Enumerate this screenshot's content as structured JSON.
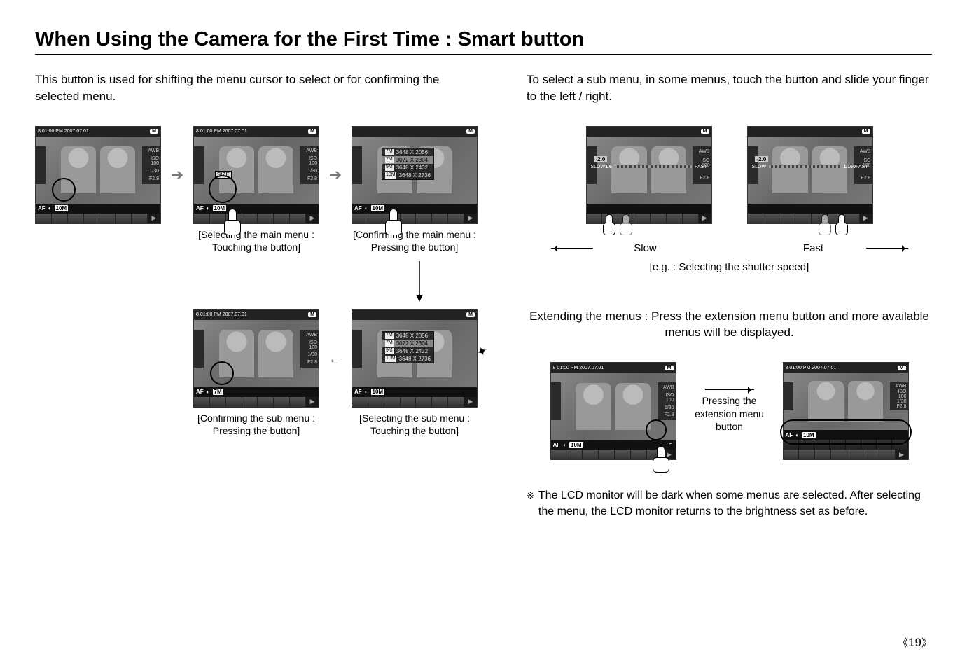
{
  "title": "When Using the Camera for the First Time : Smart button",
  "left": {
    "intro": "This button is used for shifting the menu cursor to select or for confirming the selected menu.",
    "screens": {
      "s1": {
        "topbar": "8   01:00 PM 2007.07.01",
        "right": {
          "awb": "AWB",
          "iso": "ISO 100",
          "shutter": "1/30",
          "aperture": "F2.8"
        },
        "bottom": {
          "af": "AF",
          "val": "10M"
        }
      },
      "s2": {
        "topbar": "8   01:00 PM 2007.07.01",
        "right": {
          "awb": "AWB",
          "iso": "ISO 100",
          "shutter": "1/30",
          "aperture": "F2.8"
        },
        "bottom": {
          "af": "AF",
          "val": "10M"
        },
        "size_label": "SIZE",
        "caption1": "[Selecting the main menu :",
        "caption2": "Touching the button]"
      },
      "s3": {
        "menu": [
          {
            "tag": "7M",
            "text": "3648 X 2056"
          },
          {
            "tag": "7M",
            "text": "3072 X 2304",
            "sel": true
          },
          {
            "tag": "9M",
            "text": "3648 X 2432"
          },
          {
            "tag": "10M",
            "text": "3648 X 2736"
          }
        ],
        "bottom": {
          "af": "AF",
          "val": "10M"
        },
        "caption1": "[Confirming the main menu :",
        "caption2": "Pressing the button]"
      },
      "s4": {
        "menu": [
          {
            "tag": "7M",
            "text": "3648 X 2056"
          },
          {
            "tag": "7M",
            "text": "3072 X 2304",
            "sel": true
          },
          {
            "tag": "9M",
            "text": "3648 X 2432"
          },
          {
            "tag": "10M",
            "text": "3648 X 2736"
          }
        ],
        "bottom": {
          "af": "AF",
          "val": "10M"
        },
        "caption1": "[Selecting the sub menu :",
        "caption2": "Touching the button]"
      },
      "s5": {
        "topbar": "8   01:00 PM 2007.07.01",
        "right": {
          "awb": "AWB",
          "iso": "ISO 100",
          "shutter": "1/30",
          "aperture": "F2.8"
        },
        "bottom": {
          "af": "AF",
          "val": "7M"
        },
        "caption1": "[Confirming the sub menu :",
        "caption2": "Pressing the button]"
      }
    }
  },
  "right": {
    "intro": "To select a sub menu, in some menus, touch the button and slide your finger to the left / right.",
    "slow_fast": {
      "slow_screen": {
        "ev": "-2.0",
        "shutter_label": "1.6",
        "slow": "SLOW",
        "fast": "FAST",
        "aperture": "F2.8",
        "iso": "ISO 100",
        "awb": "AWB"
      },
      "fast_screen": {
        "ev": "-2.0",
        "shutter_label": "1/160",
        "slow": "SLOW",
        "fast": "FAST",
        "aperture": "F2.8",
        "iso": "ISO 100",
        "awb": "AWB"
      },
      "slow": "Slow",
      "fast": "Fast",
      "caption": "[e.g. : Selecting the shutter speed]"
    },
    "extend": {
      "intro": "Extending the menus : Press the extension menu button and more available menus will be displayed.",
      "s1": {
        "topbar": "8   01:00 PM 2007.07.01",
        "right": {
          "awb": "AWB",
          "iso": "ISO 100",
          "shutter": "1/30",
          "aperture": "F2.8"
        },
        "bottom": {
          "af": "AF",
          "val": "10M"
        }
      },
      "mid": "Pressing the extension menu button",
      "s2": {
        "topbar": "8   01:00 PM 2007.07.01",
        "right": {
          "awb": "AWB",
          "iso": "ISO 100",
          "shutter": "1/30",
          "aperture": "F2.8"
        },
        "bottom": {
          "af": "AF",
          "val": "10M"
        }
      }
    },
    "note": "The LCD monitor will be dark when some menus are selected. After selecting the menu, the LCD monitor returns to the brightness set as before.",
    "note_mark": "※"
  },
  "page": "19"
}
